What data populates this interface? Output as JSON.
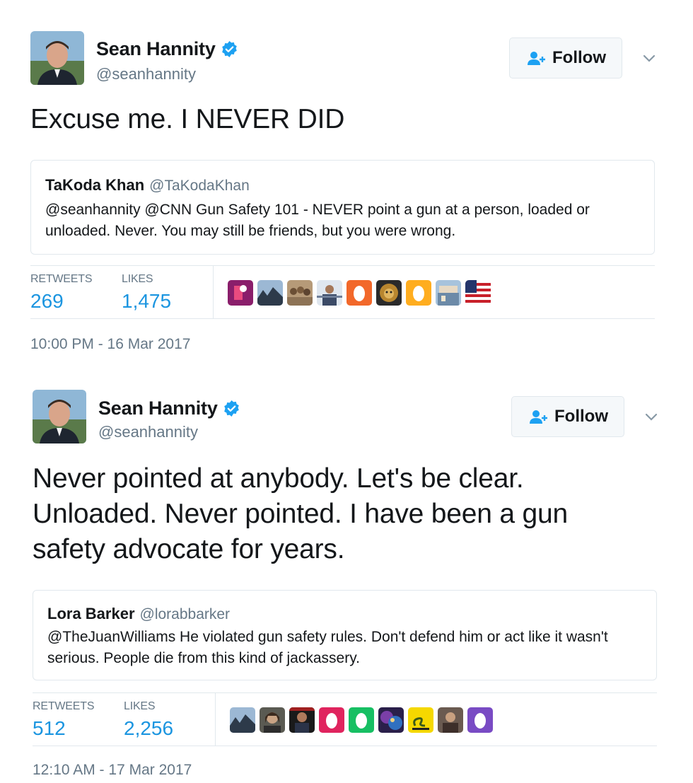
{
  "tweets": [
    {
      "author": {
        "name": "Sean Hannity",
        "handle": "@seanhannity"
      },
      "follow_label": "Follow",
      "text_lines": [
        "Excuse me. I NEVER DID"
      ],
      "quote": {
        "name": "TaKoda Khan",
        "handle": "@TaKodaKhan",
        "text": "@seanhannity @CNN Gun Safety 101 - NEVER point a gun at a person, loaded or unloaded. Never. You may still be friends, but you were wrong."
      },
      "retweets_label": "RETWEETS",
      "retweets": "269",
      "likes_label": "LIKES",
      "likes": "1,475",
      "liker_avatars": [
        "periscope-avatar",
        "landscape-avatar",
        "group-photo-avatar",
        "person-avatar",
        "egg-avatar-orange",
        "lion-avatar",
        "egg-avatar-yellow",
        "city-avatar",
        "flag-avatar"
      ],
      "timestamp": "10:00 PM - 16 Mar 2017"
    },
    {
      "author": {
        "name": "Sean Hannity",
        "handle": "@seanhannity"
      },
      "follow_label": "Follow",
      "text_lines": [
        "Never pointed at anybody. Let's be clear.",
        "Unloaded. Never pointed. I have been a gun",
        "safety advocate for years."
      ],
      "quote": {
        "name": "Lora Barker",
        "handle": "@lorabbarker",
        "text": "@TheJuanWilliams He violated gun safety rules. Don't defend him or act like it wasn't serious. People die from this kind of jackassery."
      },
      "retweets_label": "RETWEETS",
      "retweets": "512",
      "likes_label": "LIKES",
      "likes": "2,256",
      "liker_avatars": [
        "landscape-avatar",
        "woman-avatar",
        "dark-portrait-avatar",
        "egg-avatar-pink",
        "egg-avatar-green",
        "galaxy-avatar",
        "gadsden-flag-avatar",
        "man-avatar",
        "egg-avatar-purple"
      ],
      "timestamp": "12:10 AM - 17 Mar 2017"
    }
  ],
  "colors": {
    "link_blue": "#1b95e0",
    "verified_blue": "#1da1f2",
    "muted_gray": "#657786",
    "border": "#e1e8ed"
  }
}
